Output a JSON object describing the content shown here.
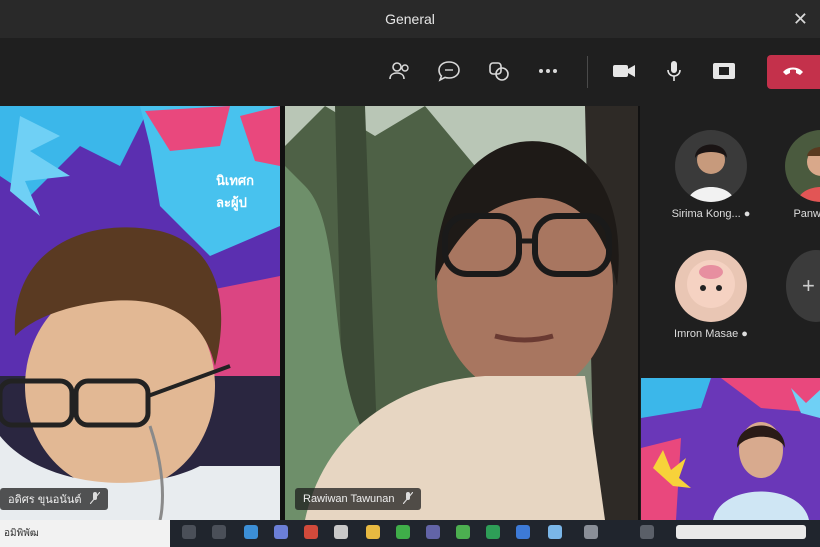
{
  "window": {
    "title": "General",
    "close_glyph": "✕"
  },
  "toolbar": {
    "icons": [
      "people-icon",
      "chat-icon",
      "reactions-icon",
      "more-icon",
      "camera-icon",
      "mic-icon",
      "share-icon",
      "leave-call-icon"
    ]
  },
  "stage": {
    "participants": [
      {
        "name": "อดิศร ขุนอนันต์",
        "banner_text_1": "นิเทศก",
        "banner_text_2": "ละผู้ป"
      },
      {
        "name": "Rawiwan Tawunan"
      }
    ]
  },
  "roster": {
    "people": [
      {
        "name": "Sirima Kong..."
      },
      {
        "name": "Panwong..."
      },
      {
        "name": "Imron Masae"
      }
    ],
    "more_label": "+"
  },
  "taskbar": {
    "search_text": "อมิพิพัฒ"
  },
  "colors": {
    "leave": "#c4314b",
    "accent_purple": "#6b2fb0",
    "accent_blue": "#3bb7ea",
    "accent_pink": "#e0457a"
  }
}
